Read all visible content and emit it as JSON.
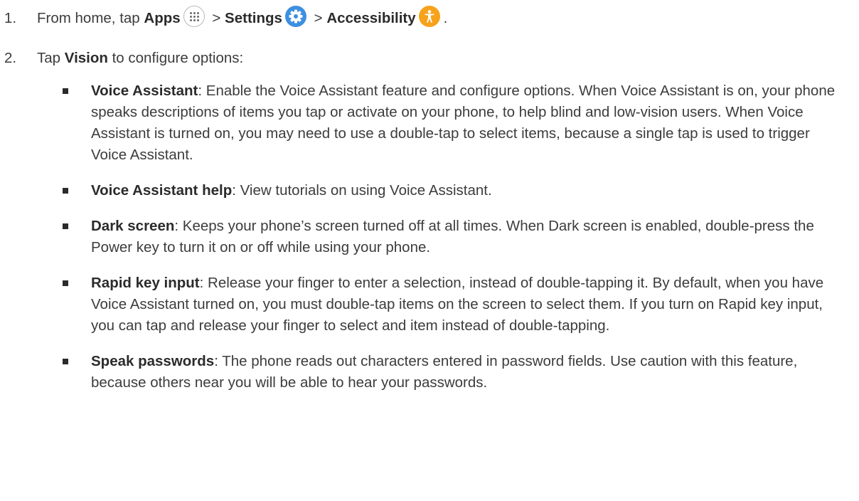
{
  "steps": [
    {
      "number": "1.",
      "prefix": "From home, tap",
      "apps_label": "Apps",
      "sep1": ">",
      "settings_label": "Settings",
      "sep2": ">",
      "accessibility_label": "Accessibility",
      "suffix": "."
    },
    {
      "number": "2.",
      "prefix": "Tap",
      "vision_label": "Vision",
      "suffix": "to configure options:"
    }
  ],
  "icons": {
    "apps": "apps-grid-icon",
    "settings": "settings-gear-icon",
    "accessibility": "accessibility-person-icon",
    "settings_color": "#3d8fe0",
    "accessibility_color": "#f6a21b"
  },
  "bullets": [
    {
      "term": "Voice Assistant",
      "desc": ": Enable the Voice Assistant feature and configure options. When Voice Assistant is on, your phone speaks descriptions of items you tap or activate on your phone, to help blind and low-vision users. When Voice Assistant is turned on, you may need to use a double-tap to select items, because a single tap is used to trigger Voice Assistant."
    },
    {
      "term": "Voice Assistant help",
      "desc": ": View tutorials on using Voice Assistant."
    },
    {
      "term": "Dark screen",
      "desc": ": Keeps your phone’s screen turned off at all times. When Dark screen is enabled, double-press the Power key to turn it on or off while using your phone."
    },
    {
      "term": "Rapid key input",
      "desc": ": Release your finger to enter a selection, instead of double-tapping it. By default, when you have Voice Assistant turned on, you must double-tap items on the screen to select them. If you turn on Rapid key input, you can tap and release your finger to select and item instead of double-tapping."
    },
    {
      "term": "Speak passwords",
      "desc": ": The phone reads out characters entered in password fields. Use caution with this feature, because others near you will be able to hear your passwords."
    }
  ]
}
